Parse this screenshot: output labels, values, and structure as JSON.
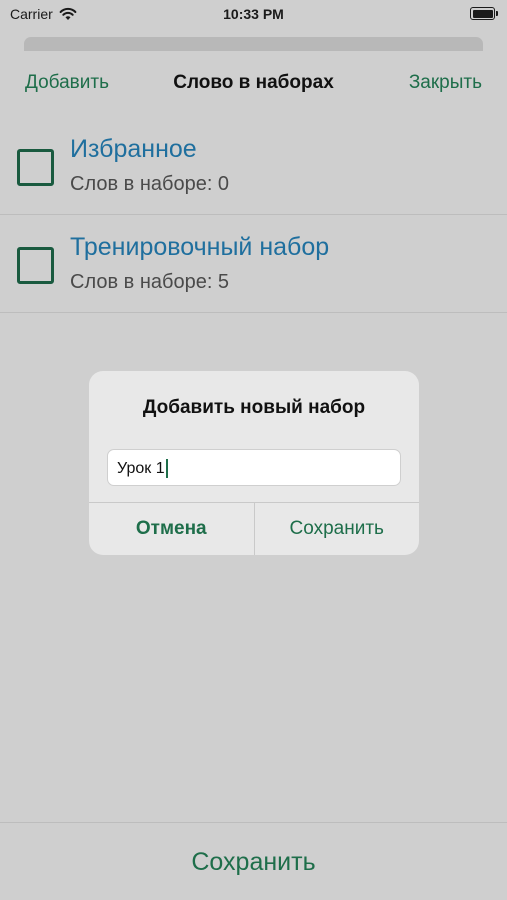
{
  "status_bar": {
    "carrier": "Carrier",
    "time": "10:33 PM"
  },
  "nav": {
    "add_label": "Добавить",
    "title": "Слово в наборах",
    "close_label": "Закрыть"
  },
  "sets": [
    {
      "name": "Избранное",
      "count_text": "Слов в наборе: 0",
      "checked": false
    },
    {
      "name": "Тренировочный набор",
      "count_text": "Слов в наборе: 5",
      "checked": false
    }
  ],
  "dialog": {
    "title": "Добавить новый набор",
    "input_value": "Урок 1",
    "cancel_label": "Отмена",
    "save_label": "Сохранить"
  },
  "footer": {
    "save_label": "Сохранить"
  },
  "colors": {
    "accent": "#1e6e4a",
    "link_blue": "#1f6f9e",
    "background": "#cfcfcf"
  }
}
